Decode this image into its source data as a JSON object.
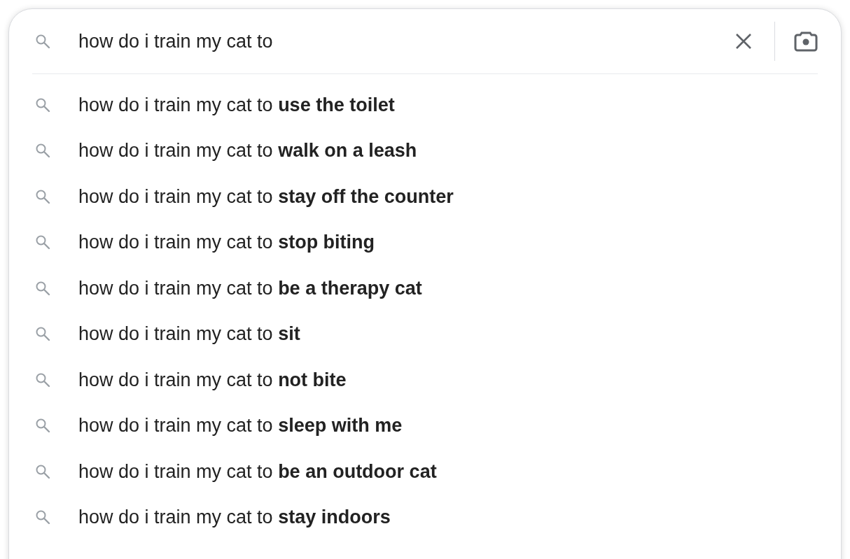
{
  "search": {
    "value": "how do i train my cat to"
  },
  "suggestions": [
    {
      "text": "how do i train my cat to **use the toilet**"
    },
    {
      "text": "how do i train my cat to **walk on a leash**"
    },
    {
      "text": "how do i train my cat to **stay off the counter**"
    },
    {
      "text": "how do i train my cat to **stop biting**"
    },
    {
      "text": "how do i train my cat to **be a therapy cat**"
    },
    {
      "text": "how do i train my cat to **sit**"
    },
    {
      "text": "how do i train my cat to **not bite**"
    },
    {
      "text": "how do i train my cat to **sleep with me**"
    },
    {
      "text": "how do i train my cat to **be an outdoor cat**"
    },
    {
      "text": "how do i train my cat to **stay indoors**"
    }
  ]
}
